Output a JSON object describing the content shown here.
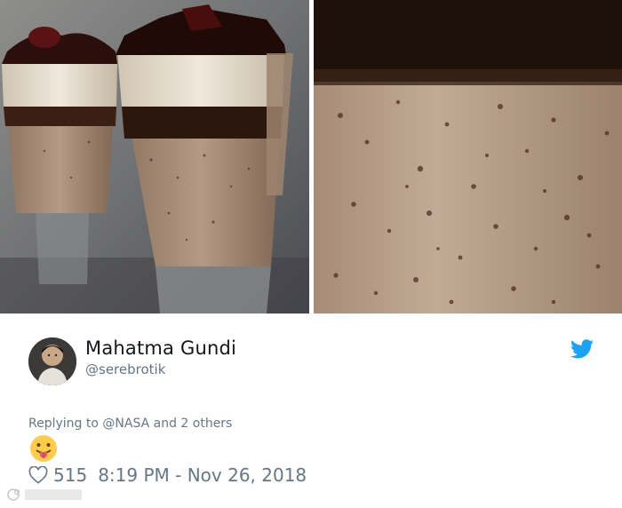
{
  "tweet": {
    "display_name": "Mahatma Gundi",
    "handle": "@serebrotik",
    "reply_prefix": "Replying to ",
    "reply_mentions": "@NASA and 2 others",
    "emoji_name": "face-with-tongue",
    "like_count": "515",
    "timestamp": "8:19 PM - Nov 26, 2018"
  },
  "icons": {
    "bird": "twitter-bird-icon",
    "heart": "heart-outline-icon"
  },
  "colors": {
    "brand_blue": "#1da1f2",
    "name_text": "#14171a",
    "secondary_text": "#657786"
  }
}
